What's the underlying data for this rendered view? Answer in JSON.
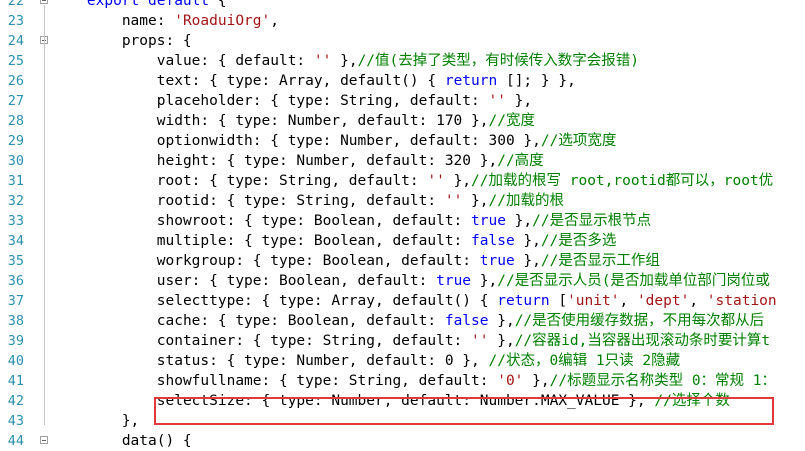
{
  "editor": {
    "lines": [
      {
        "no": "22",
        "fold": true,
        "indent": 4,
        "tokens": [
          [
            "kw",
            "export default"
          ],
          [
            "plain",
            " {"
          ]
        ]
      },
      {
        "no": "23",
        "fold": false,
        "indent": 8,
        "tokens": [
          [
            "plain",
            "name: "
          ],
          [
            "str",
            "'RoaduiOrg'"
          ],
          [
            "plain",
            ","
          ]
        ]
      },
      {
        "no": "24",
        "fold": true,
        "indent": 8,
        "tokens": [
          [
            "plain",
            "props: {"
          ]
        ]
      },
      {
        "no": "25",
        "fold": false,
        "indent": 12,
        "tokens": [
          [
            "plain",
            "value: { default: "
          ],
          [
            "str",
            "''"
          ],
          [
            "plain",
            " },"
          ],
          [
            "cm",
            "//值(去掉了类型，有时候传入数字会报错)"
          ]
        ]
      },
      {
        "no": "26",
        "fold": false,
        "indent": 12,
        "tokens": [
          [
            "plain",
            "text: { type: Array, default() { "
          ],
          [
            "kw",
            "return"
          ],
          [
            "plain",
            " []; } },"
          ]
        ]
      },
      {
        "no": "27",
        "fold": false,
        "indent": 12,
        "tokens": [
          [
            "plain",
            "placeholder: { type: String, default: "
          ],
          [
            "str",
            "''"
          ],
          [
            "plain",
            " },"
          ]
        ]
      },
      {
        "no": "28",
        "fold": false,
        "indent": 12,
        "tokens": [
          [
            "plain",
            "width: { type: Number, default: 170 },"
          ],
          [
            "cm",
            "//宽度"
          ]
        ]
      },
      {
        "no": "29",
        "fold": false,
        "indent": 12,
        "tokens": [
          [
            "plain",
            "optionwidth: { type: Number, default: 300 },"
          ],
          [
            "cm",
            "//选项宽度"
          ]
        ]
      },
      {
        "no": "30",
        "fold": false,
        "indent": 12,
        "tokens": [
          [
            "plain",
            "height: { type: Number, default: 320 },"
          ],
          [
            "cm",
            "//高度"
          ]
        ]
      },
      {
        "no": "31",
        "fold": false,
        "indent": 12,
        "tokens": [
          [
            "plain",
            "root: { type: String, default: "
          ],
          [
            "str",
            "''"
          ],
          [
            "plain",
            " },"
          ],
          [
            "cm",
            "//加载的根写 root,rootid都可以，root优"
          ]
        ]
      },
      {
        "no": "32",
        "fold": false,
        "indent": 12,
        "tokens": [
          [
            "plain",
            "rootid: { type: String, default: "
          ],
          [
            "str",
            "''"
          ],
          [
            "plain",
            " },"
          ],
          [
            "cm",
            "//加载的根"
          ]
        ]
      },
      {
        "no": "33",
        "fold": false,
        "indent": 12,
        "tokens": [
          [
            "plain",
            "showroot: { type: Boolean, default: "
          ],
          [
            "kw",
            "true"
          ],
          [
            "plain",
            " },"
          ],
          [
            "cm",
            "//是否显示根节点"
          ]
        ]
      },
      {
        "no": "34",
        "fold": false,
        "indent": 12,
        "tokens": [
          [
            "plain",
            "multiple: { type: Boolean, default: "
          ],
          [
            "kw",
            "false"
          ],
          [
            "plain",
            " },"
          ],
          [
            "cm",
            "//是否多选"
          ]
        ]
      },
      {
        "no": "35",
        "fold": false,
        "indent": 12,
        "tokens": [
          [
            "plain",
            "workgroup: { type: Boolean, default: "
          ],
          [
            "kw",
            "true"
          ],
          [
            "plain",
            " },"
          ],
          [
            "cm",
            "//是否显示工作组"
          ]
        ]
      },
      {
        "no": "36",
        "fold": false,
        "indent": 12,
        "tokens": [
          [
            "plain",
            "user: { type: Boolean, default: "
          ],
          [
            "kw",
            "true"
          ],
          [
            "plain",
            " },"
          ],
          [
            "cm",
            "//是否显示人员(是否加载单位部门岗位或"
          ]
        ]
      },
      {
        "no": "37",
        "fold": false,
        "indent": 12,
        "tokens": [
          [
            "plain",
            "selecttype: { type: Array, default() { "
          ],
          [
            "kw",
            "return"
          ],
          [
            "plain",
            " ["
          ],
          [
            "str",
            "'unit'"
          ],
          [
            "plain",
            ", "
          ],
          [
            "str",
            "'dept'"
          ],
          [
            "plain",
            ", "
          ],
          [
            "str",
            "'station"
          ]
        ]
      },
      {
        "no": "38",
        "fold": false,
        "indent": 12,
        "tokens": [
          [
            "plain",
            "cache: { type: Boolean, default: "
          ],
          [
            "kw",
            "false"
          ],
          [
            "plain",
            " },"
          ],
          [
            "cm",
            "//是否使用缓存数据，不用每次都从后"
          ]
        ]
      },
      {
        "no": "39",
        "fold": false,
        "indent": 12,
        "tokens": [
          [
            "plain",
            "container: { type: String, default: "
          ],
          [
            "str",
            "''"
          ],
          [
            "plain",
            " },"
          ],
          [
            "cm",
            "//容器id,当容器出现滚动条时要计算t"
          ]
        ]
      },
      {
        "no": "40",
        "fold": false,
        "indent": 12,
        "tokens": [
          [
            "plain",
            "status: { type: Number, default: 0 }, "
          ],
          [
            "cm",
            "//状态，0编辑 1只读 2隐藏"
          ]
        ]
      },
      {
        "no": "41",
        "fold": false,
        "indent": 12,
        "tokens": [
          [
            "plain",
            "showfullname: { type: String, default: "
          ],
          [
            "str",
            "'0'"
          ],
          [
            "plain",
            " },"
          ],
          [
            "cm",
            "//标题显示名称类型 0：常规 1："
          ]
        ]
      },
      {
        "no": "42",
        "fold": false,
        "indent": 12,
        "tokens": [
          [
            "plain",
            "selectSize: { type: Number, default: Number.MAX_VALUE }, "
          ],
          [
            "cm",
            "//选择个数"
          ]
        ]
      },
      {
        "no": "43",
        "fold": false,
        "indent": 8,
        "tokens": [
          [
            "plain",
            "},"
          ]
        ]
      },
      {
        "no": "44",
        "fold": true,
        "indent": 8,
        "tokens": [
          [
            "plain",
            "data() {"
          ]
        ]
      }
    ]
  }
}
